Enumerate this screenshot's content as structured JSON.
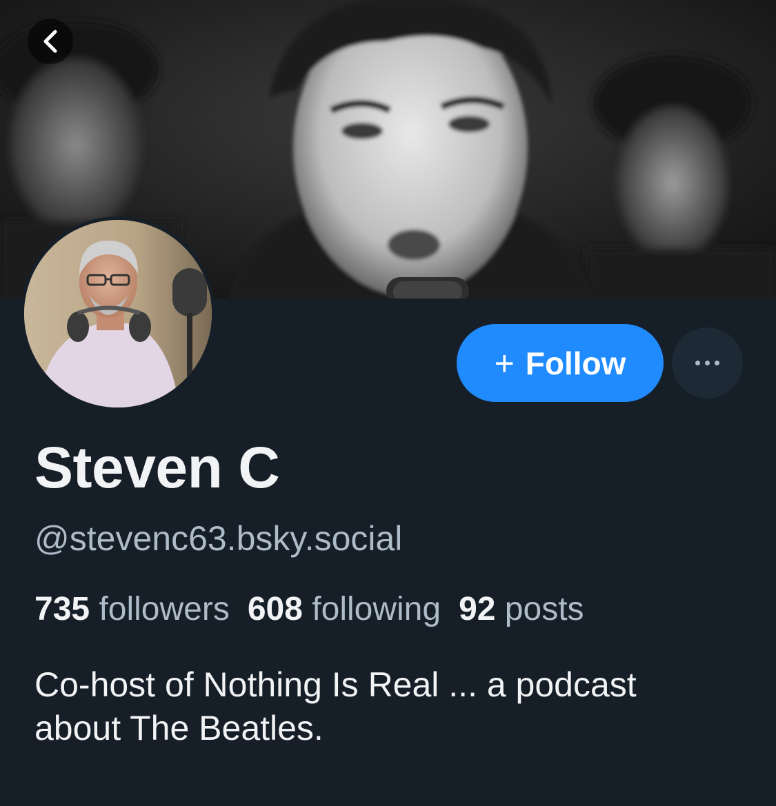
{
  "profile": {
    "display_name": "Steven C",
    "handle": "@stevenc63.bsky.social",
    "bio": "Co-host of Nothing Is Real ... a podcast about The Beatles."
  },
  "stats": {
    "followers_count": "735",
    "followers_label": "followers",
    "following_count": "608",
    "following_label": "following",
    "posts_count": "92",
    "posts_label": "posts"
  },
  "actions": {
    "follow_label": "Follow",
    "follow_icon": "plus-icon",
    "more_icon": "ellipsis-icon",
    "back_icon": "chevron-left-icon"
  },
  "colors": {
    "background": "#161e27",
    "accent": "#208bfe",
    "text_primary": "#f1f3f5",
    "text_secondary": "#aebbc9"
  }
}
